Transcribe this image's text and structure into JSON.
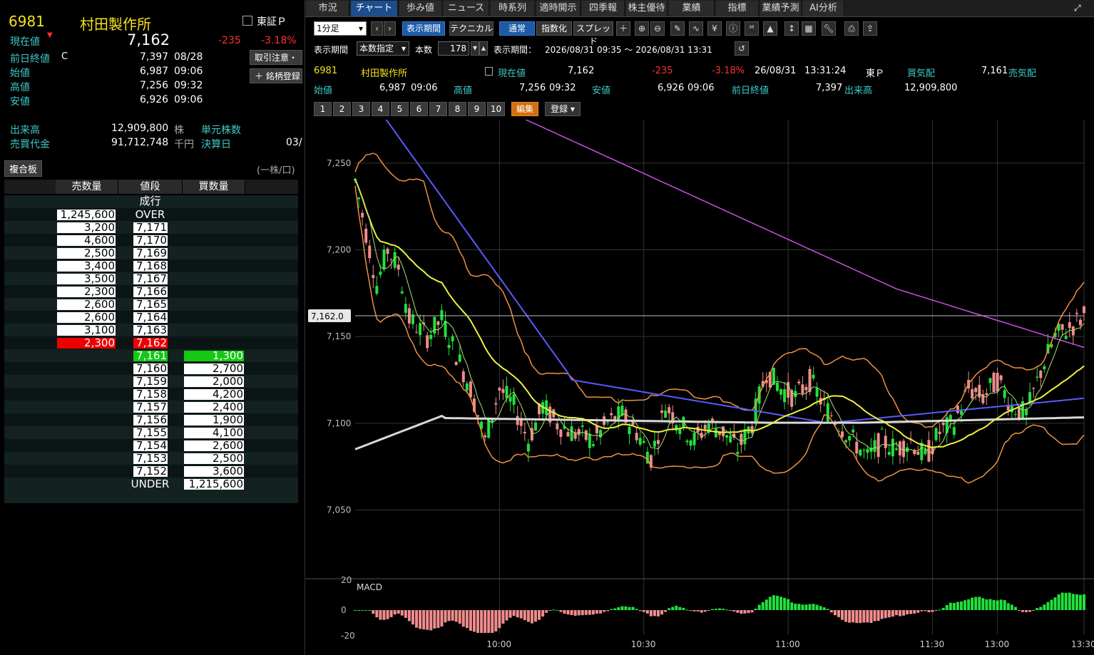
{
  "left": {
    "code": "6981",
    "name": "村田製作所",
    "market": "東証Ｐ",
    "current_label": "現在値",
    "current_price": "7,162",
    "change": "-235",
    "change_pct": "-3.18%",
    "prev_close_label": "前日終値",
    "prev_close_flag": "C",
    "prev_close": "7,397",
    "prev_close_date": "08/28",
    "open_label": "始値",
    "open": "6,987",
    "open_time": "09:06",
    "high_label": "高値",
    "high": "7,256",
    "high_time": "09:32",
    "low_label": "安値",
    "low": "6,926",
    "low_time": "09:06",
    "notice_button": "取引注意・",
    "register_button": "銘柄登録",
    "volume_label": "出来高",
    "volume": "12,909,800",
    "volume_unit": "株",
    "unit_shares_label": "単元株数",
    "turnover_label": "売買代金",
    "turnover": "91,712,748",
    "turnover_unit": "千円",
    "settlement_label": "決算日",
    "settlement_value": "03/",
    "board_button": "複合板",
    "per_unit_note": "(一株/口)",
    "book_headers": {
      "sell": "売数量",
      "price": "値段",
      "buy": "買数量"
    },
    "market_order_label": "成行",
    "book": [
      {
        "sell": "1,245,600",
        "price": "OVER",
        "buy": "",
        "kind": "over"
      },
      {
        "sell": "3,200",
        "price": "7,171",
        "buy": "",
        "kind": "ask"
      },
      {
        "sell": "4,600",
        "price": "7,170",
        "buy": "",
        "kind": "ask"
      },
      {
        "sell": "2,500",
        "price": "7,169",
        "buy": "",
        "kind": "ask"
      },
      {
        "sell": "3,400",
        "price": "7,168",
        "buy": "",
        "kind": "ask"
      },
      {
        "sell": "3,500",
        "price": "7,167",
        "buy": "",
        "kind": "ask"
      },
      {
        "sell": "2,300",
        "price": "7,166",
        "buy": "",
        "kind": "ask"
      },
      {
        "sell": "2,600",
        "price": "7,165",
        "buy": "",
        "kind": "ask"
      },
      {
        "sell": "2,600",
        "price": "7,164",
        "buy": "",
        "kind": "ask"
      },
      {
        "sell": "3,100",
        "price": "7,163",
        "buy": "",
        "kind": "ask"
      },
      {
        "sell": "2,300",
        "price": "7,162",
        "buy": "",
        "kind": "best_ask"
      },
      {
        "sell": "",
        "price": "7,161",
        "buy": "1,300",
        "kind": "best_bid"
      },
      {
        "sell": "",
        "price": "7,160",
        "buy": "2,700",
        "kind": "bid"
      },
      {
        "sell": "",
        "price": "7,159",
        "buy": "2,000",
        "kind": "bid"
      },
      {
        "sell": "",
        "price": "7,158",
        "buy": "4,200",
        "kind": "bid"
      },
      {
        "sell": "",
        "price": "7,157",
        "buy": "2,400",
        "kind": "bid"
      },
      {
        "sell": "",
        "price": "7,156",
        "buy": "1,900",
        "kind": "bid"
      },
      {
        "sell": "",
        "price": "7,155",
        "buy": "4,100",
        "kind": "bid"
      },
      {
        "sell": "",
        "price": "7,154",
        "buy": "2,600",
        "kind": "bid"
      },
      {
        "sell": "",
        "price": "7,153",
        "buy": "2,500",
        "kind": "bid"
      },
      {
        "sell": "",
        "price": "7,152",
        "buy": "3,600",
        "kind": "bid"
      },
      {
        "sell": "",
        "price": "UNDER",
        "buy": "1,215,600",
        "kind": "under"
      }
    ]
  },
  "tabs": [
    "市況",
    "チャート",
    "歩み値",
    "ニュース",
    "時系列",
    "適時開示",
    "四季報",
    "株主優待",
    "業績",
    "指標",
    "業績予測",
    "AI分析"
  ],
  "active_tab": "チャート",
  "toolbar": {
    "interval": "1分足",
    "period_button": "表示期間",
    "technical_button": "テクニカル",
    "normal_button": "通常",
    "index_button": "指数化",
    "spread_button": "スプレッド",
    "period_label": "表示期間",
    "period_mode": "本数指定",
    "count_label": "本数",
    "count": "178",
    "range_label": "表示期間：",
    "range": "2026/08/31 09:35 ～ 2026/08/31 13:31"
  },
  "quote": {
    "code": "6981",
    "name": "村田製作所",
    "current_label": "現在値",
    "current": "7,162",
    "change": "-235",
    "change_pct": "-3.18%",
    "date": "26/08/31",
    "time": "13:31:24",
    "market": "東Ｐ",
    "bid_label": "買気配",
    "bid": "7,161",
    "ask_label": "売気配",
    "open_label": "始値",
    "open": "6,987",
    "open_time": "09:06",
    "high_label": "高値",
    "high": "7,256",
    "high_time": "09:32",
    "low_label": "安値",
    "low": "6,926",
    "low_time": "09:06",
    "prev_label": "前日終値",
    "prev": "7,397",
    "volume_label": "出来高",
    "volume": "12,909,800"
  },
  "number_tabs": [
    "1",
    "2",
    "3",
    "4",
    "5",
    "6",
    "7",
    "8",
    "9",
    "10"
  ],
  "edit_button": "編集",
  "register_dropdown": "登録",
  "colors": {
    "up": "#22e03c",
    "down": "#f08c8c",
    "ma_short": "#f0f040",
    "ma_mid": "#5a5aff",
    "ma_long": "#c850e0",
    "ma_day": "#d8d8d8",
    "bollinger": "#f09040",
    "macd_up": "#22e03c",
    "macd_down": "#f08c8c"
  },
  "chart_data": {
    "type": "candlestick",
    "interval": "1m",
    "y_ticks": [
      7050,
      7100,
      7150,
      7200,
      7250
    ],
    "y_tick_labels": [
      "7,050",
      "7,100",
      "7,150",
      "7,200",
      "7,250"
    ],
    "x_tick_labels": [
      "10:00",
      "10:30",
      "11:00",
      "11:30",
      "13:00",
      "13:30"
    ],
    "current_price_label": "7,162.0",
    "current_price": 7162.0,
    "macd_label": "MACD",
    "macd_ticks": [
      "20",
      "0",
      "-20"
    ],
    "price_path_sketch": [
      [
        0,
        7240
      ],
      [
        3,
        7210
      ],
      [
        6,
        7180
      ],
      [
        9,
        7200
      ],
      [
        12,
        7190
      ],
      [
        15,
        7160
      ],
      [
        20,
        7150
      ],
      [
        24,
        7160
      ],
      [
        28,
        7140
      ],
      [
        32,
        7120
      ],
      [
        36,
        7090
      ],
      [
        40,
        7120
      ],
      [
        44,
        7110
      ],
      [
        48,
        7090
      ],
      [
        52,
        7110
      ],
      [
        56,
        7100
      ],
      [
        60,
        7095
      ],
      [
        66,
        7090
      ],
      [
        70,
        7100
      ],
      [
        74,
        7105
      ],
      [
        78,
        7095
      ],
      [
        82,
        7080
      ],
      [
        86,
        7110
      ],
      [
        90,
        7100
      ],
      [
        94,
        7090
      ],
      [
        98,
        7100
      ],
      [
        102,
        7095
      ],
      [
        106,
        7085
      ],
      [
        110,
        7100
      ],
      [
        114,
        7130
      ],
      [
        118,
        7120
      ],
      [
        122,
        7115
      ],
      [
        126,
        7125
      ],
      [
        130,
        7110
      ],
      [
        134,
        7100
      ],
      [
        138,
        7090
      ],
      [
        142,
        7080
      ],
      [
        146,
        7090
      ],
      [
        150,
        7085
      ],
      [
        154,
        7090
      ],
      [
        158,
        7080
      ],
      [
        162,
        7095
      ],
      [
        166,
        7100
      ],
      [
        170,
        7120
      ],
      [
        174,
        7115
      ],
      [
        178,
        7125
      ],
      [
        182,
        7110
      ],
      [
        186,
        7105
      ],
      [
        190,
        7130
      ],
      [
        194,
        7150
      ],
      [
        198,
        7155
      ],
      [
        202,
        7162
      ]
    ]
  }
}
